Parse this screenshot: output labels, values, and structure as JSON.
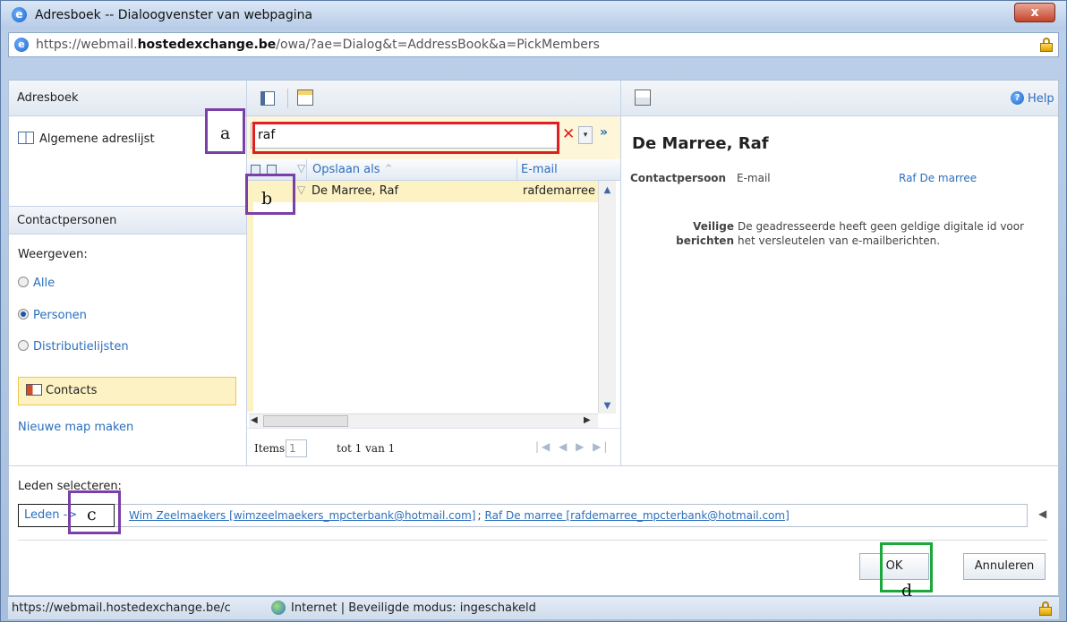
{
  "window": {
    "title": "Adresboek -- Dialoogvenster van webpagina",
    "close_label": "x",
    "url_prefix": "https://webmail.",
    "url_domain": "hostedexchange.be",
    "url_path": "/owa/?ae=Dialog&t=AddressBook&a=PickMembers"
  },
  "left": {
    "header": "Adresboek",
    "global_list": "Algemene adreslijst",
    "contacts_header": "Contactpersonen",
    "show_label": "Weergeven:",
    "filters": [
      {
        "label": "Alle",
        "selected": false
      },
      {
        "label": "Personen",
        "selected": true
      },
      {
        "label": "Distributielijsten",
        "selected": false
      }
    ],
    "contacts_folder": "Contacts",
    "new_folder": "Nieuwe map maken"
  },
  "middle": {
    "search_value": "raf",
    "columns": {
      "name": "Opslaan als",
      "email": "E-mail"
    },
    "rows": [
      {
        "name": "De Marree, Raf",
        "email": "rafdemarree"
      }
    ],
    "pager": {
      "items_label": "Items",
      "page": "1",
      "of_label": "tot 1 van 1"
    }
  },
  "right": {
    "help": "Help",
    "contact_name": "De Marree, Raf",
    "contact_label": "Contactpersoon",
    "email_label": "E-mail",
    "email_link": "Raf De marree",
    "secure_label_1": "Veilige",
    "secure_label_2": "berichten",
    "secure_text": "De geadresseerde heeft geen geldige digitale id voor het versleutelen van e-mailberichten."
  },
  "bottom": {
    "select_label": "Leden selecteren:",
    "members_button": "Leden ->",
    "recipients": [
      "Wim Zeelmaekers [wimzeelmaekers_mpcterbank@hotmail.com]",
      "Raf De marree [rafdemarree_mpcterbank@hotmail.com]"
    ],
    "ok": "OK",
    "cancel": "Annuleren"
  },
  "annotations": {
    "a": "a",
    "b": "b",
    "c": "c",
    "d": "d",
    "colors": {
      "purple": "#7b3fa8",
      "red": "#e02020",
      "green": "#1aa83a"
    }
  },
  "status": {
    "url": "https://webmail.hostedexchange.be/c",
    "zone": "Internet | Beveiligde modus: ingeschakeld"
  }
}
